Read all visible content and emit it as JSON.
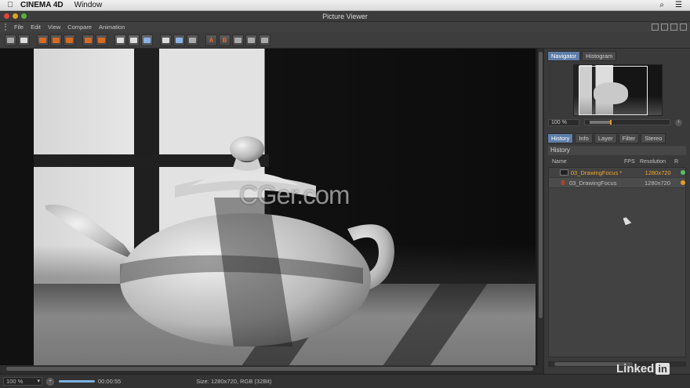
{
  "macbar": {
    "apple": "",
    "app_name": "CINEMA 4D",
    "menu_window": "Window",
    "search": "⌕",
    "list": "☰"
  },
  "window": {
    "title": "Picture Viewer"
  },
  "menu": [
    "File",
    "Edit",
    "View",
    "Compare",
    "Animation"
  ],
  "viewer": {
    "watermark": "CGer.com"
  },
  "status": {
    "zoom": "100 %",
    "time": "00:00:55",
    "size": "Size: 1280x720, RGB (32Bit)"
  },
  "panel": {
    "top_tabs": [
      "Navigator",
      "Histogram"
    ],
    "nav_zoom": "100 %",
    "nav_zoom_fraction": 0.22,
    "bottom_tabs": [
      "History",
      "Info",
      "Layer",
      "Filter",
      "Stereo"
    ],
    "history_title": "History",
    "columns": {
      "name": "Name",
      "fps": "FPS",
      "resolution": "Resolution",
      "r": "R"
    },
    "rows": [
      {
        "name": "03_DrawingFocus *",
        "resolution": "1280x720",
        "dot": "#55c060",
        "active": true
      },
      {
        "name": "03_DrawingFocus",
        "resolution": "1280x720",
        "dot": "#e0a020",
        "active": false
      }
    ]
  },
  "brand": {
    "linked": "Linked",
    "in": "in"
  },
  "colors": {
    "accent_tab": "#5e7ea8",
    "active_row": "#f2a62a",
    "close": "#e0443e",
    "minimize": "#dea123",
    "zoom": "#56b13f"
  }
}
